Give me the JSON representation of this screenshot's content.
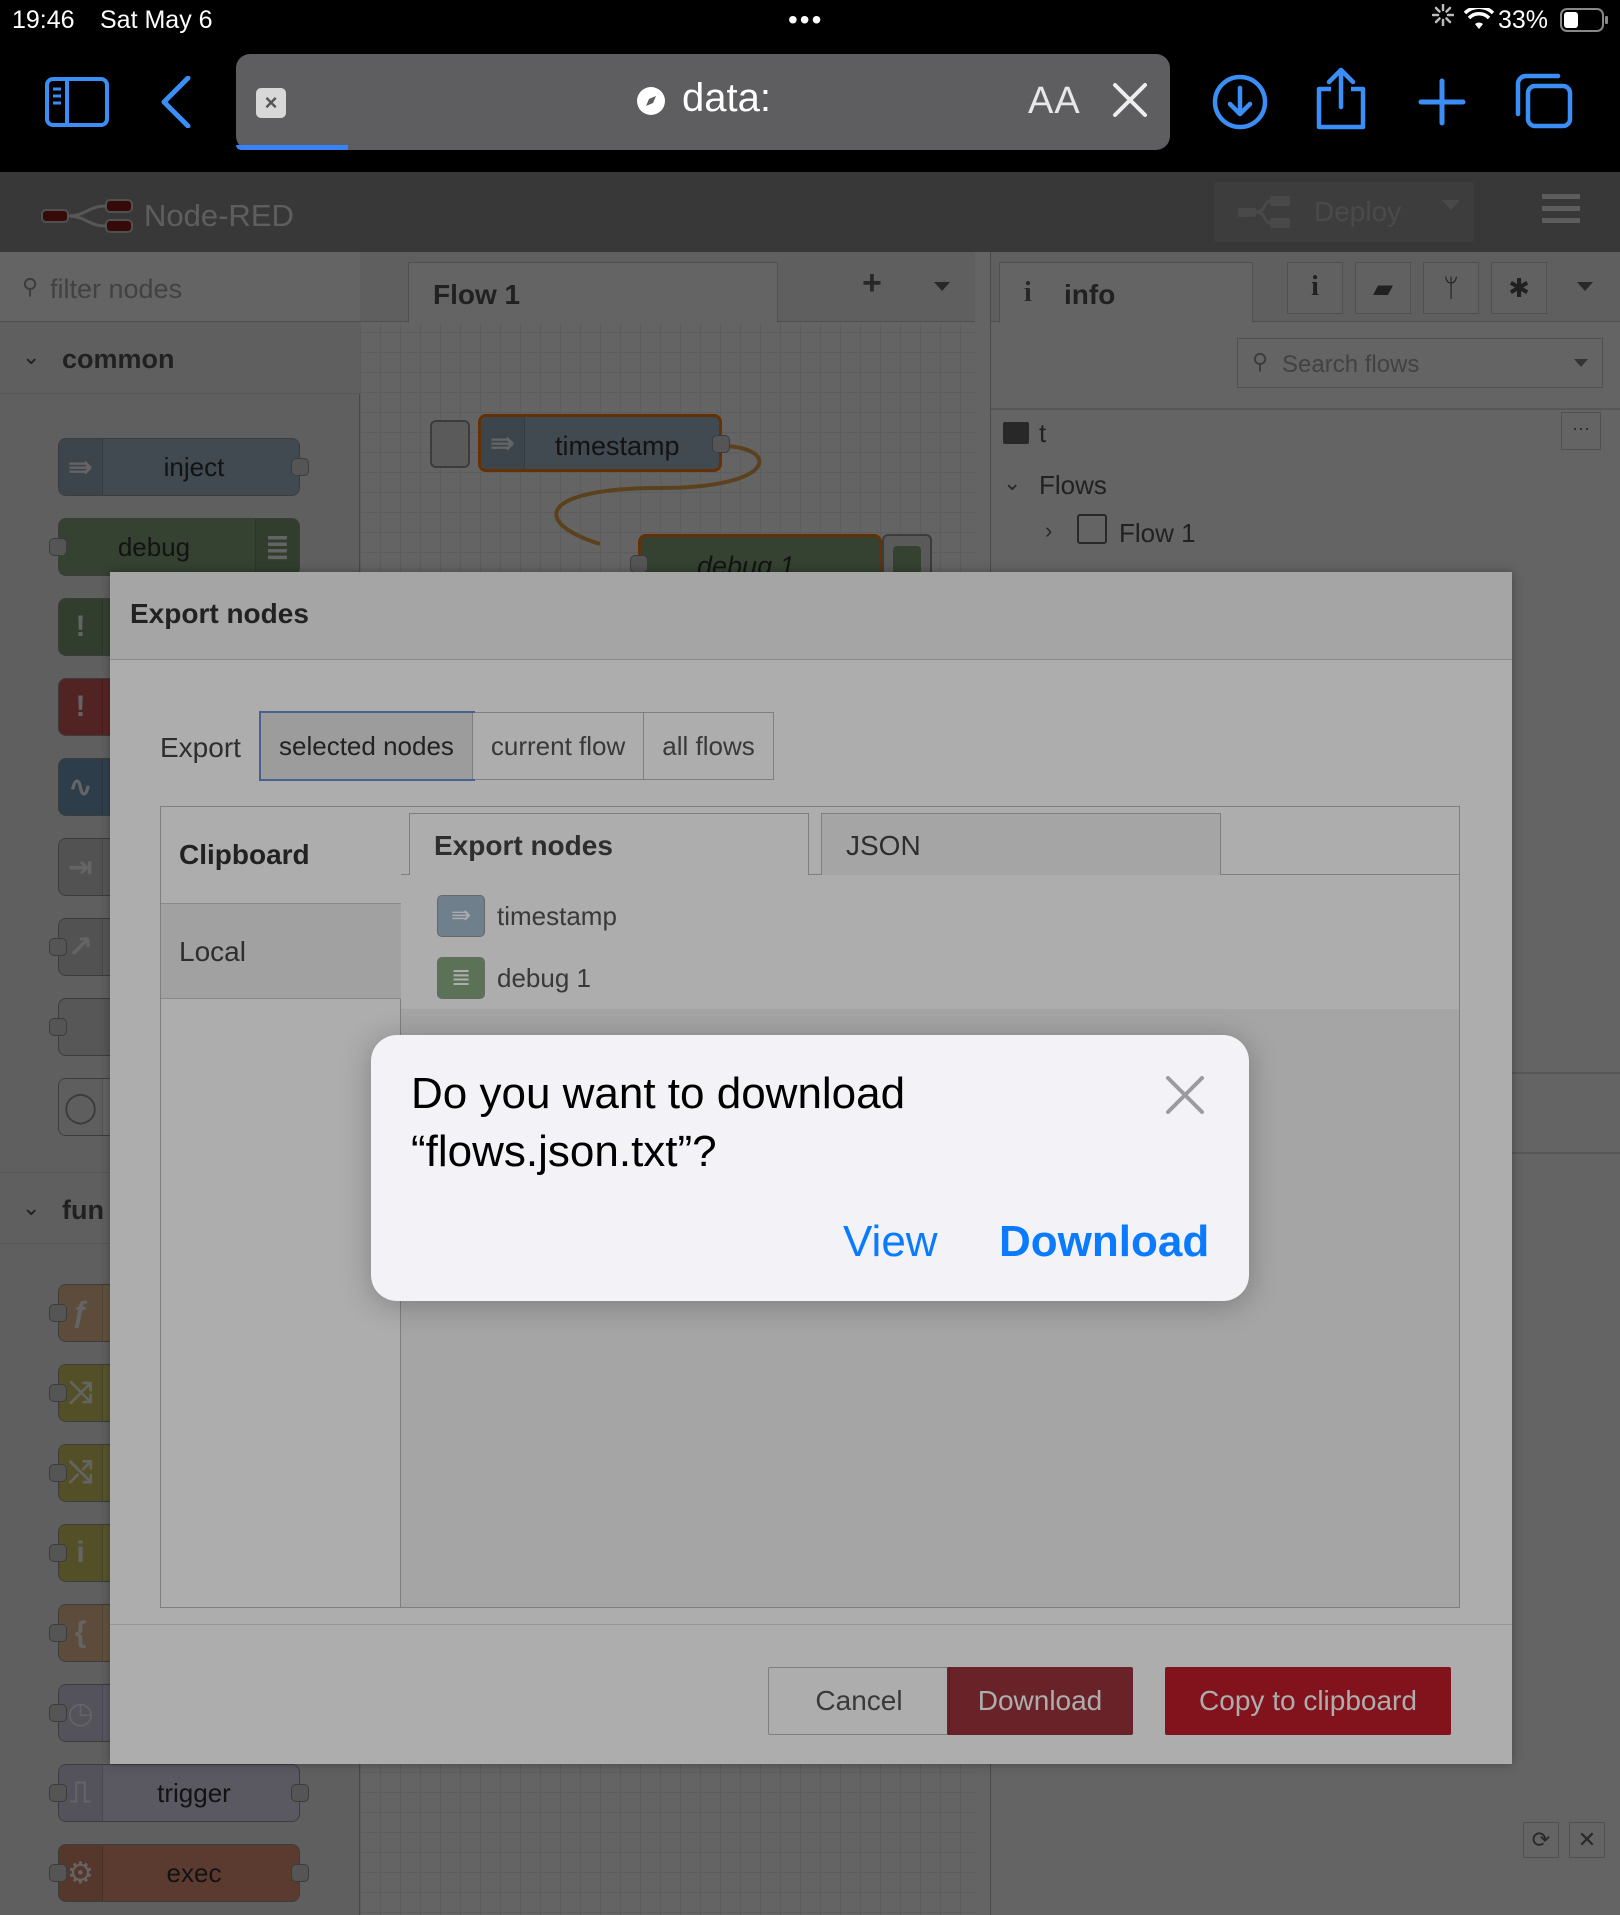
{
  "status": {
    "time": "19:46",
    "date": "Sat May 6",
    "battery": "33%"
  },
  "safari": {
    "url": "data:",
    "text_size": "AA"
  },
  "nodered": {
    "brand": "Node-RED",
    "deploy_label": "Deploy",
    "filter_placeholder": "filter nodes",
    "palette": {
      "category_common": "common",
      "category_function": "fun",
      "nodes_common": [
        "inject",
        "debug"
      ],
      "nodes_function_tail": [
        "trigger",
        "exec"
      ]
    },
    "workspace": {
      "tab": "Flow 1",
      "nodes": [
        "timestamp",
        "debug 1"
      ]
    },
    "sidebar": {
      "tab_label": "info",
      "search_placeholder": "Search flows",
      "tree_root": "t",
      "flows_label": "Flows",
      "flow_item": "Flow 1"
    }
  },
  "export_dialog": {
    "title": "Export nodes",
    "export_label": "Export",
    "scope_options": [
      "selected nodes",
      "current flow",
      "all flows"
    ],
    "selected_scope": "selected nodes",
    "targets": [
      "Clipboard",
      "Local"
    ],
    "tabs": [
      "Export nodes",
      "JSON"
    ],
    "items": [
      {
        "label": "timestamp",
        "color": "#a6bbcf"
      },
      {
        "label": "debug 1",
        "color": "#87a980"
      }
    ],
    "cancel_label": "Cancel",
    "download_label": "Download",
    "copy_label": "Copy to clipboard"
  },
  "download_alert": {
    "message": "Do you want to download “flows.json.txt”?",
    "view_label": "View",
    "download_label": "Download"
  },
  "colors": {
    "ios_blue": "#0a7aff",
    "nodered_red": "#8c101c",
    "inject_node": "#a6bbcf",
    "debug_node": "#87a980"
  }
}
